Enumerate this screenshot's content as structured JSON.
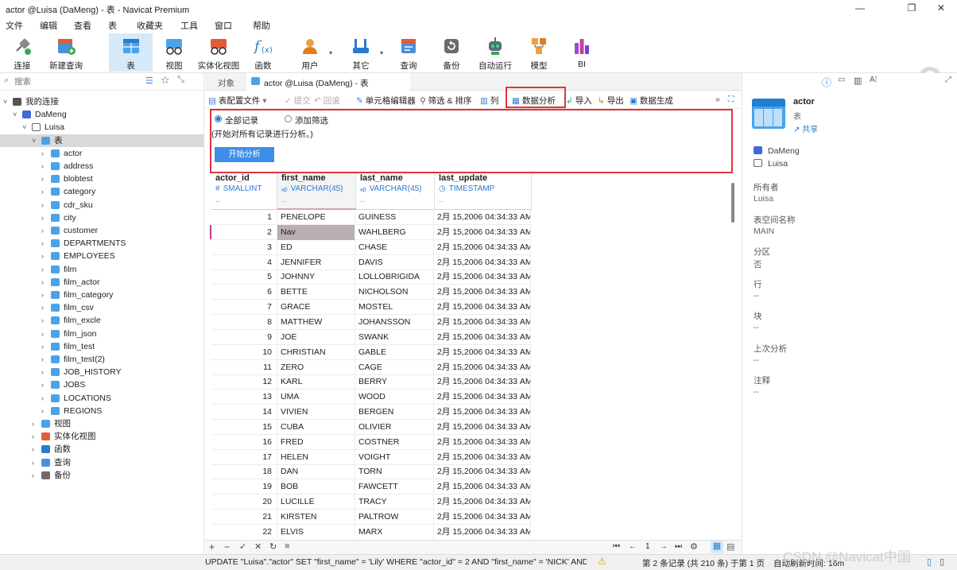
{
  "window": {
    "title": "actor @Luisa (DaMeng) - 表 - Navicat Premium",
    "min": "—",
    "max": "❐",
    "close": "✕"
  },
  "menu": [
    "文件",
    "编辑",
    "查看",
    "表",
    "收藏夹",
    "工具",
    "窗口",
    "帮助"
  ],
  "toolbar": [
    {
      "label": "连接",
      "icon": "plug-icon"
    },
    {
      "label": "新建查询",
      "icon": "new-query-icon"
    },
    {
      "label": "表",
      "icon": "table-icon",
      "active": true
    },
    {
      "label": "视图",
      "icon": "view-icon"
    },
    {
      "label": "实体化视图",
      "icon": "materialized-view-icon"
    },
    {
      "label": "函数",
      "icon": "function-icon"
    },
    {
      "label": "用户",
      "icon": "user-icon"
    },
    {
      "label": "其它",
      "icon": "tools-icon"
    },
    {
      "label": "查询",
      "icon": "query-icon"
    },
    {
      "label": "备份",
      "icon": "backup-icon"
    },
    {
      "label": "自动运行",
      "icon": "robot-icon"
    },
    {
      "label": "模型",
      "icon": "model-icon"
    },
    {
      "label": "BI",
      "icon": "bi-icon"
    }
  ],
  "sidebar": {
    "search_placeholder": "搜索",
    "root": "我的连接",
    "connection": "DaMeng",
    "schema": "Luisa",
    "tables_folder": "表",
    "tables": [
      "actor",
      "address",
      "blobtest",
      "category",
      "cdr_sku",
      "city",
      "customer",
      "DEPARTMENTS",
      "EMPLOYEES",
      "film",
      "film_actor",
      "film_category",
      "film_csv",
      "film_excle",
      "film_json",
      "film_test",
      "film_test(2)",
      "JOB_HISTORY",
      "JOBS",
      "LOCATIONS",
      "REGIONS"
    ],
    "other_folders": [
      "视图",
      "实体化视图",
      "函数",
      "查询",
      "备份"
    ]
  },
  "tabs": {
    "objects": "对象",
    "active": "actor @Luisa (DaMeng) - 表"
  },
  "subtoolbar": {
    "config": "表配置文件",
    "commit": "提交",
    "rollback": "回滚",
    "cell_editor": "单元格编辑器",
    "filter_sort": "筛选 & 排序",
    "columns": "列",
    "data_analysis": "数据分析",
    "import": "导入",
    "export": "导出",
    "data_gen": "数据生成"
  },
  "analysis": {
    "opt_all": "全部记录",
    "opt_filter": "添加筛选",
    "desc": "(开始对所有记录进行分析。)",
    "start_btn": "开始分析"
  },
  "columns": [
    {
      "name": "actor_id",
      "type": "SMALLINT",
      "icon": "#"
    },
    {
      "name": "first_name",
      "type": "VARCHAR(45)",
      "icon": "ₐᵦ"
    },
    {
      "name": "last_name",
      "type": "VARCHAR(45)",
      "icon": "ₐᵦ"
    },
    {
      "name": "last_update",
      "type": "TIMESTAMP",
      "icon": "◷"
    }
  ],
  "col_placeholder": "--",
  "rows": [
    [
      "1",
      "PENELOPE",
      "GUINESS",
      "2月 15,2006 04:34:33 AM"
    ],
    [
      "2",
      "Nav",
      "WAHLBERG",
      "2月 15,2006 04:34:33 AM"
    ],
    [
      "3",
      "ED",
      "CHASE",
      "2月 15,2006 04:34:33 AM"
    ],
    [
      "4",
      "JENNIFER",
      "DAVIS",
      "2月 15,2006 04:34:33 AM"
    ],
    [
      "5",
      "JOHNNY",
      "LOLLOBRIGIDA",
      "2月 15,2006 04:34:33 AM"
    ],
    [
      "6",
      "BETTE",
      "NICHOLSON",
      "2月 15,2006 04:34:33 AM"
    ],
    [
      "7",
      "GRACE",
      "MOSTEL",
      "2月 15,2006 04:34:33 AM"
    ],
    [
      "8",
      "MATTHEW",
      "JOHANSSON",
      "2月 15,2006 04:34:33 AM"
    ],
    [
      "9",
      "JOE",
      "SWANK",
      "2月 15,2006 04:34:33 AM"
    ],
    [
      "10",
      "CHRISTIAN",
      "GABLE",
      "2月 15,2006 04:34:33 AM"
    ],
    [
      "11",
      "ZERO",
      "CAGE",
      "2月 15,2006 04:34:33 AM"
    ],
    [
      "12",
      "KARL",
      "BERRY",
      "2月 15,2006 04:34:33 AM"
    ],
    [
      "13",
      "UMA",
      "WOOD",
      "2月 15,2006 04:34:33 AM"
    ],
    [
      "14",
      "VIVIEN",
      "BERGEN",
      "2月 15,2006 04:34:33 AM"
    ],
    [
      "15",
      "CUBA",
      "OLIVIER",
      "2月 15,2006 04:34:33 AM"
    ],
    [
      "16",
      "FRED",
      "COSTNER",
      "2月 15,2006 04:34:33 AM"
    ],
    [
      "17",
      "HELEN",
      "VOIGHT",
      "2月 15,2006 04:34:33 AM"
    ],
    [
      "18",
      "DAN",
      "TORN",
      "2月 15,2006 04:34:33 AM"
    ],
    [
      "19",
      "BOB",
      "FAWCETT",
      "2月 15,2006 04:34:33 AM"
    ],
    [
      "20",
      "LUCILLE",
      "TRACY",
      "2月 15,2006 04:34:33 AM"
    ],
    [
      "21",
      "KIRSTEN",
      "PALTROW",
      "2月 15,2006 04:34:33 AM"
    ],
    [
      "22",
      "ELVIS",
      "MARX",
      "2月 15,2006 04:34:33 AM"
    ]
  ],
  "pager": {
    "page": "1"
  },
  "statusbar": {
    "sql": "UPDATE \"Luisa\".\"actor\" SET \"first_name\" = 'Lily' WHERE \"actor_id\" = 2 AND \"first_name\" = 'NICK' AND '",
    "record": "第 2 条记录 (共 210 条) 于第 1 页",
    "refresh": "自动刷新时间: 16m"
  },
  "props": {
    "name": "actor",
    "kind": "表",
    "share": "共享",
    "connection": "DaMeng",
    "schema": "Luisa",
    "items": [
      {
        "label": "所有者",
        "value": "Luisa"
      },
      {
        "label": "表空间名称",
        "value": "MAIN"
      },
      {
        "label": "分区",
        "value": "否"
      },
      {
        "label": "行",
        "value": "--"
      },
      {
        "label": "块",
        "value": "--"
      },
      {
        "label": "上次分析",
        "value": "--"
      },
      {
        "label": "注释",
        "value": "--"
      }
    ]
  },
  "watermark": "CSDN @Navicat中国",
  "colors": {
    "accent": "#2a7bd0",
    "highlight": "#e0343c",
    "button": "#3d8ee8"
  }
}
